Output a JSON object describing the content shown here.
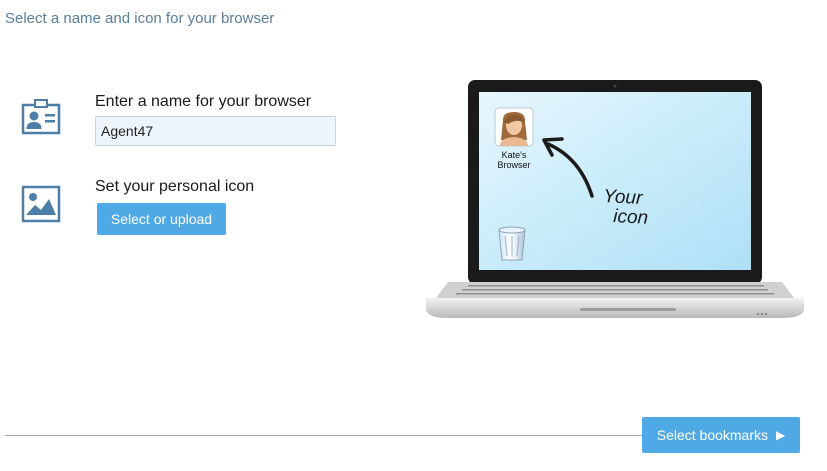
{
  "header": {
    "title": "Select a name and icon for your browser"
  },
  "name_section": {
    "label": "Enter a name for your browser",
    "input_value": "Agent47",
    "icon": "id-card-icon"
  },
  "icon_section": {
    "label": "Set your personal icon",
    "button_label": "Select or upload",
    "icon": "picture-icon"
  },
  "preview": {
    "profile_label_line1": "Kate's",
    "profile_label_line2": "Browser",
    "handwriting_line1": "Your",
    "handwriting_line2": "icon",
    "desktop_icons": [
      "profile-photo-icon",
      "recycle-bin-icon"
    ]
  },
  "footer": {
    "next_label": "Select bookmarks",
    "next_icon": "play-arrow-icon"
  },
  "colors": {
    "accent": "#4fa9e4",
    "header_text": "#5a7f9c",
    "icon_blue": "#4d7ea8"
  }
}
